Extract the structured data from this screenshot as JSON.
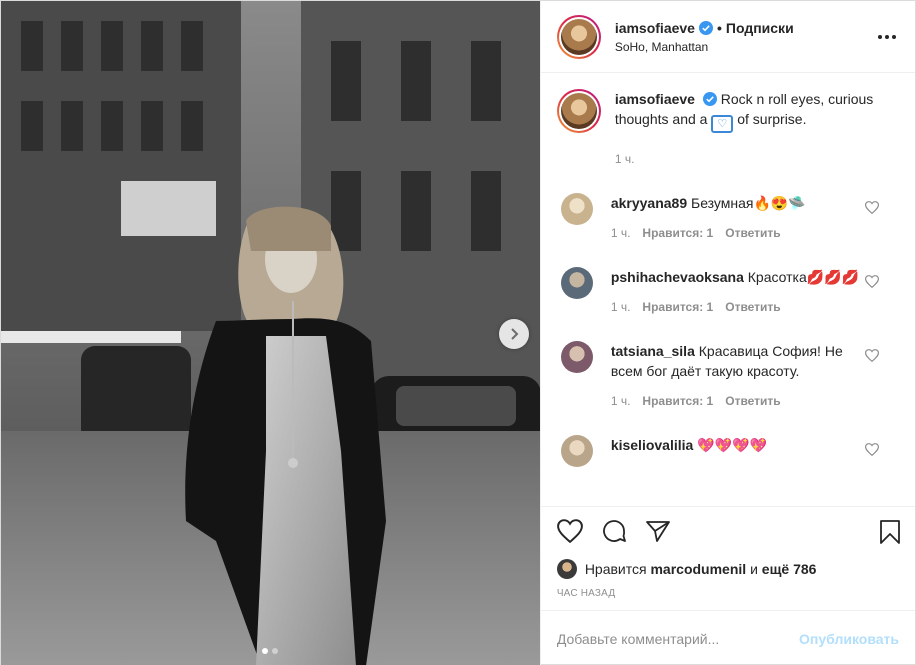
{
  "post": {
    "author": {
      "username": "iamsofiaeve",
      "verified_icon": "verified-badge-icon",
      "follow_label": "Подписки",
      "location": "SoHo, Manhattan"
    },
    "photo": {
      "carousel_total": 2,
      "carousel_active": 1
    },
    "caption": {
      "username": "iamsofiaeve",
      "text_before": "Rock n roll eyes, curious thoughts and a",
      "text_after": "of surprise.",
      "emoji_icon": "heart-box-emoji-icon",
      "time": "1 ч."
    },
    "comments": [
      {
        "username": "akryyana89",
        "text": "Безумная🔥😍🛸",
        "time": "1 ч.",
        "likes_label": "Нравится: 1",
        "reply_label": "Ответить",
        "avatar_color": "#c9b28e"
      },
      {
        "username": "pshihachevaoksana",
        "text": "Красотка💋💋💋",
        "time": "1 ч.",
        "likes_label": "Нравится: 1",
        "reply_label": "Ответить",
        "avatar_color": "#5a6a78"
      },
      {
        "username": "tatsiana_sila",
        "text": "Красавица София! Не всем бог даёт такую красоту.",
        "time": "1 ч.",
        "likes_label": "Нравится: 1",
        "reply_label": "Ответить",
        "avatar_color": "#7d5a6a"
      },
      {
        "username": "kiseliovalilia",
        "text": "💖💖💖💖",
        "time": "",
        "likes_label": "",
        "reply_label": "",
        "avatar_color": "#b9a58a"
      }
    ],
    "likes": {
      "prefix": "Нравится",
      "user": "marcodumenil",
      "middle": "и",
      "rest": "ещё 786"
    },
    "posted_ago": "ЧАС НАЗАД",
    "add_comment": {
      "placeholder": "Добавьте комментарий...",
      "publish_label": "Опубликовать"
    }
  },
  "colors": {
    "accent": "#0095f6",
    "publish_disabled": "#b2dffc",
    "verified": "#3897f0",
    "muted": "#8e8e8e"
  }
}
